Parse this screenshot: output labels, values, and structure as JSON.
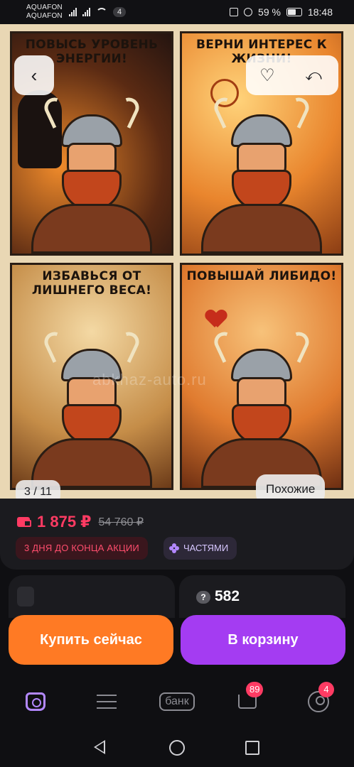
{
  "status_bar": {
    "carrier_1": "AQUAFON",
    "carrier_2": "AQUAFON",
    "sim_badge": "4",
    "battery": "59 %",
    "time": "18:48"
  },
  "gallery": {
    "panels": [
      "ПОВЫСЬ УРОВЕНЬ ЭНЕРГИИ!",
      "ВЕРНИ ИНТЕРЕС К ЖИЗНИ!",
      "ИЗБАВЬСЯ ОТ ЛИШНЕГО ВЕСА!",
      "ПОВЫШАЙ ЛИБИДО!"
    ],
    "watermark": "abkhaz-auto.ru",
    "counter": "3 / 11",
    "similar_label": "Похожие",
    "icons": {
      "back": "chevron-left-icon",
      "favorite": "heart-icon",
      "share": "share-icon"
    }
  },
  "price": {
    "current": "1 875 ₽",
    "old": "54 760 ₽",
    "promo_label": "3 ДНЯ ДО КОНЦА АКЦИИ",
    "installments_label": "ЧАСТЯМИ"
  },
  "questions": {
    "count": "582",
    "icon": "?"
  },
  "actions": {
    "buy_now": "Купить сейчас",
    "add_to_cart": "В корзину"
  },
  "bottom_nav": {
    "bank_label": "банк",
    "cart_badge": "89",
    "profile_badge": "4"
  },
  "colors": {
    "accent_price": "#ff3b63",
    "buy_button": "#ff7a24",
    "cart_button": "#a43cf2",
    "nav_active": "#b388ff"
  }
}
